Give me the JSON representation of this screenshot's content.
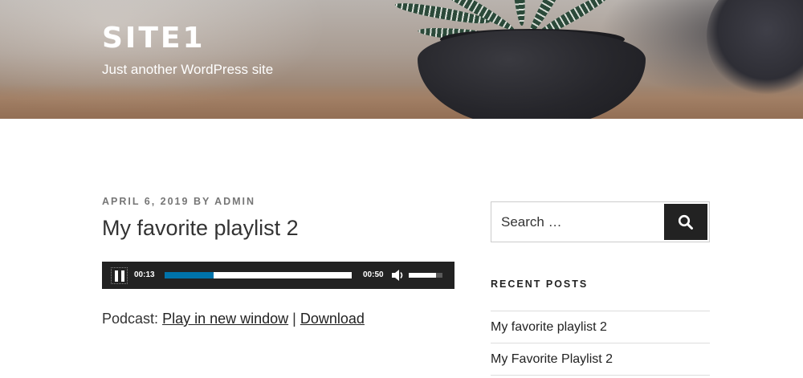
{
  "header": {
    "site_title": "SITE1",
    "site_description": "Just another WordPress site"
  },
  "post": {
    "date": "APRIL 6, 2019",
    "by_label": "BY",
    "author": "ADMIN",
    "title": "My favorite playlist 2",
    "audio": {
      "current_time": "00:13",
      "duration": "00:50",
      "progress_fraction": 0.26,
      "volume_fraction": 0.8,
      "state": "playing",
      "accent_color": "#0073aa"
    },
    "podcast_label": "Podcast:",
    "play_link": "Play in new window",
    "separator": "|",
    "download_link": "Download"
  },
  "sidebar": {
    "search": {
      "placeholder": "Search …",
      "button_icon": "search-icon"
    },
    "recent_posts_title": "RECENT POSTS",
    "recent_posts": [
      "My favorite playlist 2",
      "My Favorite Playlist 2"
    ]
  }
}
